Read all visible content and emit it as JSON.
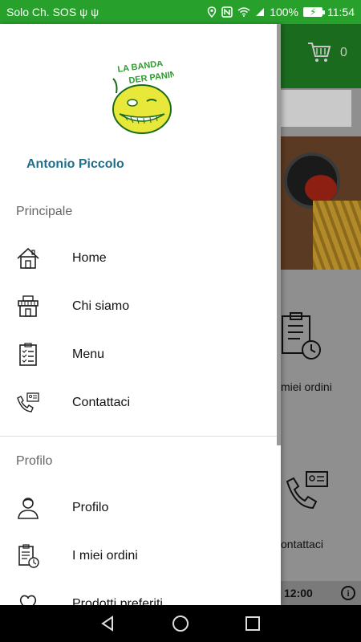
{
  "status_bar": {
    "carrier": "Solo Ch. SOS",
    "battery": "100%",
    "time": "11:54",
    "color": "#28a02c"
  },
  "background_app": {
    "cart_count": "0",
    "card1_label": "miei ordini",
    "card2_label": "ontattaci",
    "time_label": "12:00"
  },
  "drawer": {
    "logo_text": "LA BANDA DER PANINO",
    "user_name": "Antonio Piccolo",
    "sections": {
      "main": {
        "title": "Principale",
        "items": [
          {
            "label": "Home",
            "icon": "house-icon"
          },
          {
            "label": "Chi siamo",
            "icon": "shop-icon"
          },
          {
            "label": "Menu",
            "icon": "menu-list-icon"
          },
          {
            "label": "Contattaci",
            "icon": "phone-contact-icon"
          }
        ]
      },
      "profile": {
        "title": "Profilo",
        "items": [
          {
            "label": "Profilo",
            "icon": "user-icon"
          },
          {
            "label": "I miei ordini",
            "icon": "orders-icon"
          },
          {
            "label": "Prodotti preferiti",
            "icon": "heart-icon"
          }
        ]
      }
    }
  }
}
